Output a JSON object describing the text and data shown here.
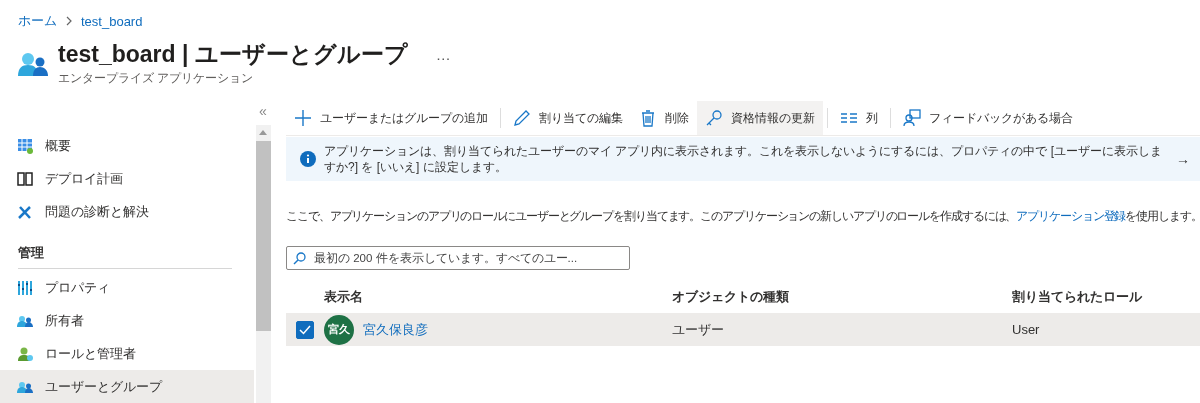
{
  "breadcrumb": [
    "ホーム",
    "test_board"
  ],
  "header": {
    "title": "test_board | ユーザーとグループ",
    "more": "…",
    "subtitle": "エンタープライズ アプリケーション"
  },
  "sidebar": {
    "collapse": "«",
    "sections": [
      {
        "items": [
          {
            "label": "概要",
            "selected": false
          },
          {
            "label": "デプロイ計画",
            "selected": false
          },
          {
            "label": "問題の診断と解決",
            "selected": false
          }
        ]
      },
      {
        "heading": "管理",
        "items": [
          {
            "label": "プロパティ",
            "selected": false
          },
          {
            "label": "所有者",
            "selected": false
          },
          {
            "label": "ロールと管理者",
            "selected": false
          },
          {
            "label": "ユーザーとグループ",
            "selected": true
          }
        ]
      }
    ]
  },
  "toolbar": [
    {
      "label": "ユーザーまたはグループの追加",
      "hovered": false
    },
    {
      "label": "割り当ての編集",
      "hovered": false
    },
    {
      "label": "削除",
      "hovered": false
    },
    {
      "label": "資格情報の更新",
      "hovered": true
    },
    {
      "label": "列",
      "hovered": false
    },
    {
      "label": "フィードバックがある場合",
      "hovered": false
    }
  ],
  "info_bar": {
    "text": "アプリケーションは、割り当てられたユーザーのマイ アプリ内に表示されます。これを表示しないようにするには、プロパティの中で [ユーザーに表示しますか?] を [いいえ] に設定します。",
    "arrow": "→"
  },
  "description": {
    "text": "ここで、アプリケーションのアプリのロールにユーザーとグループを割り当てます。このアプリケーションの新しいアプリのロールを作成するには、",
    "link": "アプリケーション登録",
    "after": "を使用します。"
  },
  "search": {
    "placeholder": "最初の 200 件を表示しています。すべてのユー..."
  },
  "table": {
    "columns": [
      "表示名",
      "オブジェクトの種類",
      "割り当てられたロール"
    ],
    "rows": [
      {
        "checked": true,
        "selected": true,
        "initials": "宮久",
        "color": "#1e7145",
        "name": "宮久保良彦",
        "type": "ユーザー",
        "role": "User"
      }
    ]
  }
}
